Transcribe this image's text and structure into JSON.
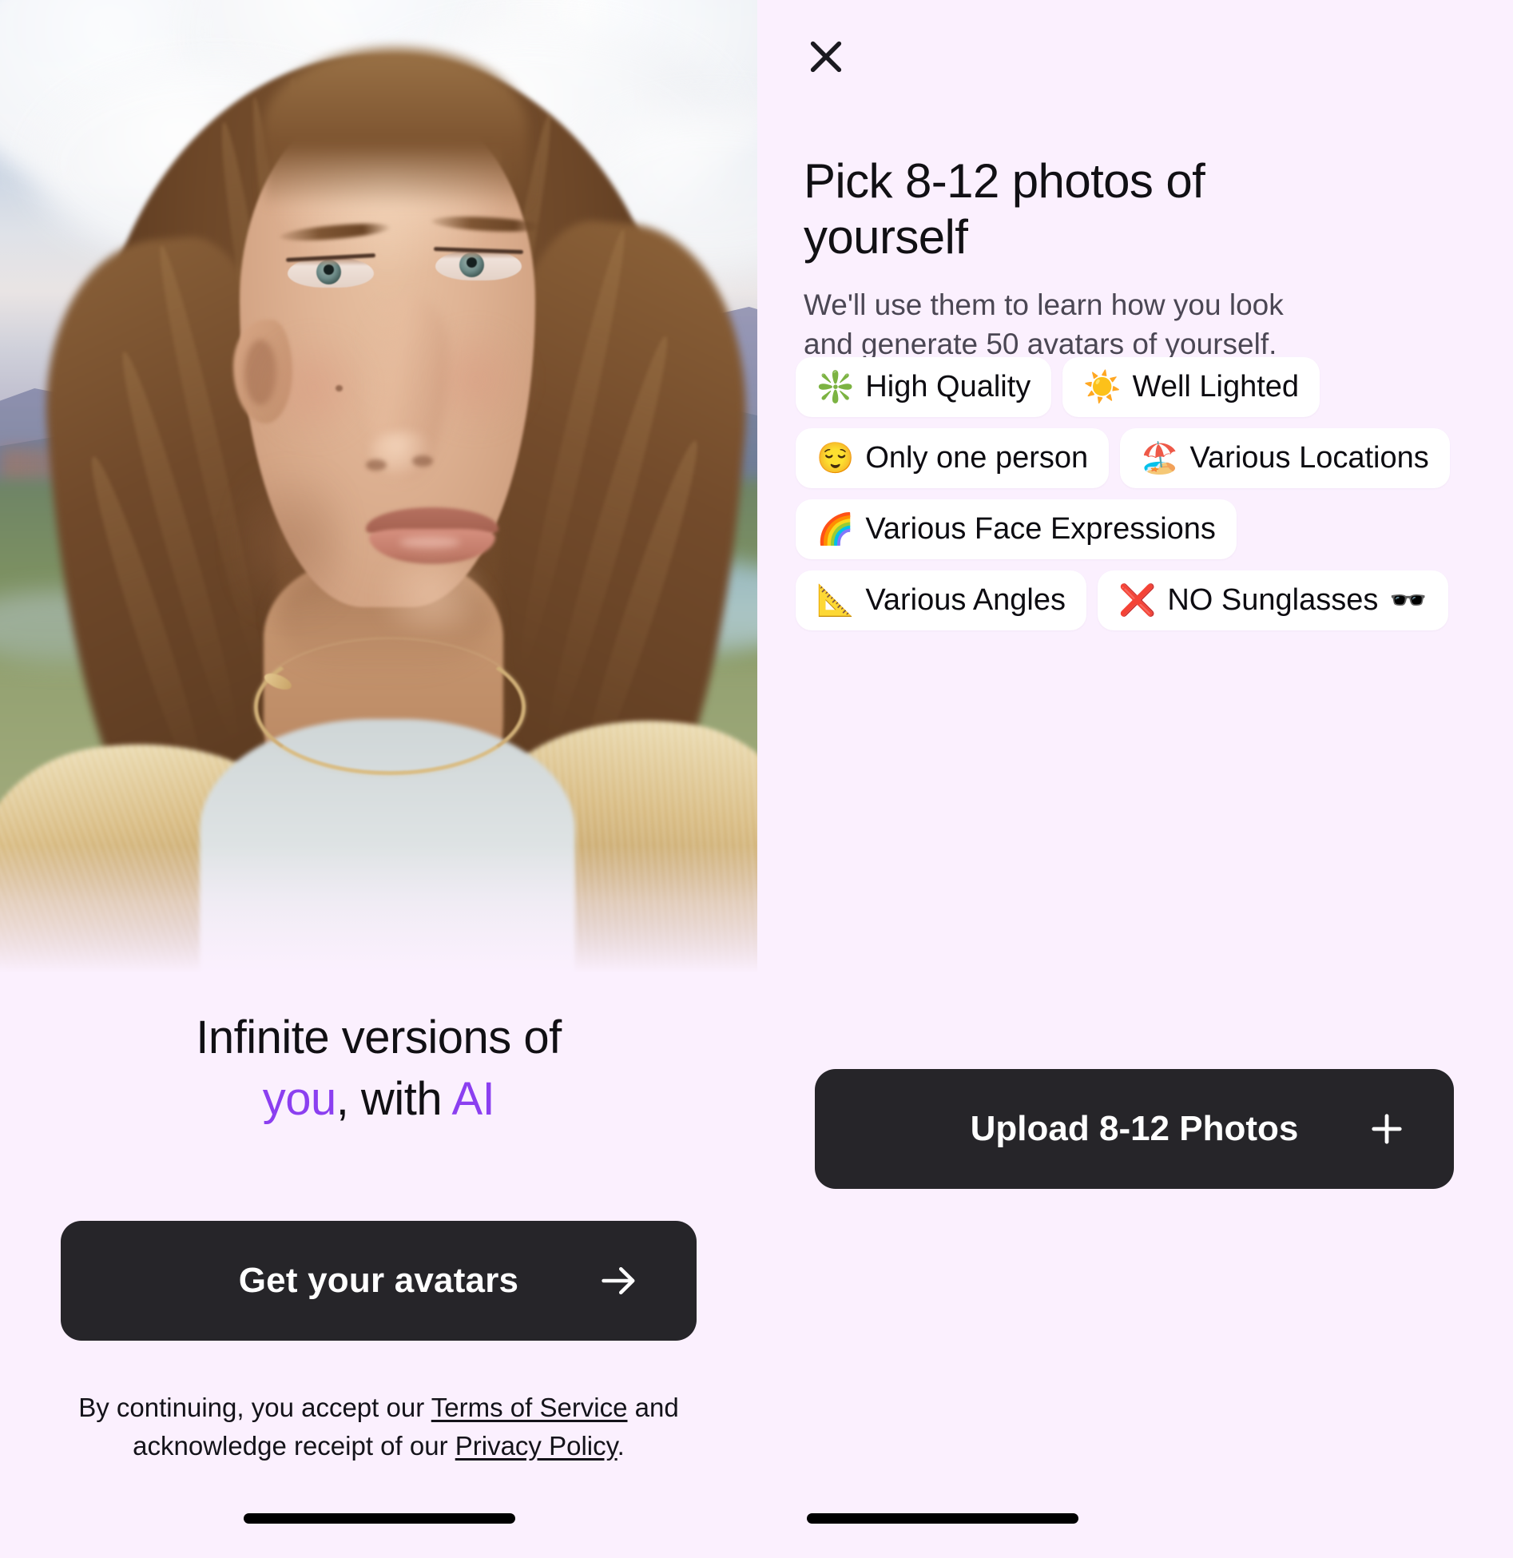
{
  "hero": {
    "alt": "AI-generated portrait of a woman with long brown hair wearing a fur-lined coat in a mountain landscape"
  },
  "left": {
    "tagline_line1": "Infinite versions of",
    "tagline_you": "you",
    "tagline_comma_with": ", with ",
    "tagline_ai": "AI",
    "cta_label": "Get your avatars",
    "cta_icon": "arrow-right-icon",
    "legal_prefix": "By continuing, you accept our ",
    "legal_terms": "Terms of Service",
    "legal_middle": " and acknowledge receipt of our ",
    "legal_privacy": "Privacy Policy",
    "legal_suffix": "."
  },
  "right": {
    "close_icon": "close-icon",
    "title": "Pick 8-12 photos of yourself",
    "subtitle": "We'll use them to learn how you look and generate 50 avatars of yourself.",
    "chips": [
      {
        "emoji_lead": "❇️",
        "label": "High Quality",
        "emoji_trail": "",
        "icon_name": "sparkle-icon"
      },
      {
        "emoji_lead": "☀️",
        "label": "Well Lighted",
        "emoji_trail": "",
        "icon_name": "sun-icon"
      },
      {
        "emoji_lead": "😌",
        "label": "Only one person",
        "emoji_trail": "",
        "icon_name": "relieved-face-icon"
      },
      {
        "emoji_lead": "🏖️",
        "label": "Various Locations",
        "emoji_trail": "",
        "icon_name": "beach-icon"
      },
      {
        "emoji_lead": "🌈",
        "label": "Various Face Expressions",
        "emoji_trail": "",
        "icon_name": "rainbow-icon"
      },
      {
        "emoji_lead": "📐",
        "label": "Various Angles",
        "emoji_trail": "",
        "icon_name": "triangle-ruler-icon"
      },
      {
        "emoji_lead": "❌",
        "label": "NO Sunglasses",
        "emoji_trail": "🕶️",
        "icon_name": "cross-mark-icon"
      }
    ],
    "upload_label": "Upload 8-12 Photos",
    "upload_icon": "plus-icon"
  },
  "colors": {
    "background": "#fbf0fe",
    "chip_background": "#ffffff",
    "button_background": "#262529",
    "button_text": "#ffffff",
    "accent_purple": "#8b3ff0",
    "title_text": "#111014",
    "subtitle_text": "#4b4754"
  }
}
